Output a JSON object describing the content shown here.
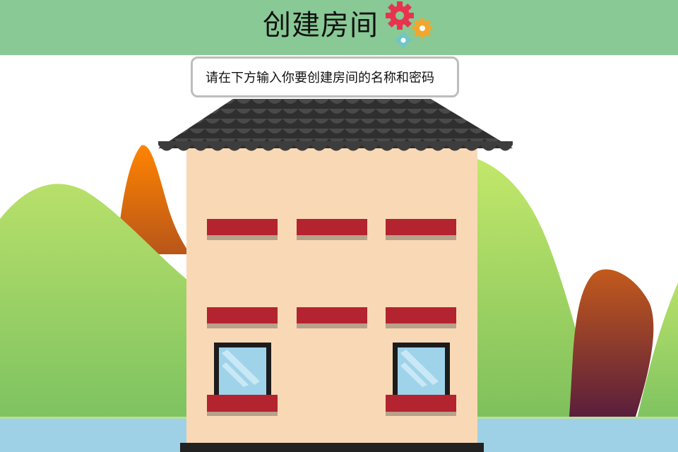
{
  "header": {
    "title": "创建房间",
    "bg_color": "#88c995",
    "icon": "gears-icon"
  },
  "prompt": {
    "text": "请在下方输入你要创建房间的名称和密码"
  },
  "scene": {
    "icons": [
      "hill-icon",
      "tree-icon",
      "house-icon",
      "roof-icon",
      "window-icon",
      "river-icon"
    ],
    "colors": {
      "sky": "#ffffff",
      "hill_green": "#9fd66a",
      "tree_orange": "#ff8400",
      "tree_brown": "#b8561a",
      "house_wall": "#f9d9b5",
      "roof": "#3d3d3d",
      "shutter_red": "#b42330",
      "window_glass": "#9fd3ea",
      "river": "#9ed0e6"
    }
  }
}
